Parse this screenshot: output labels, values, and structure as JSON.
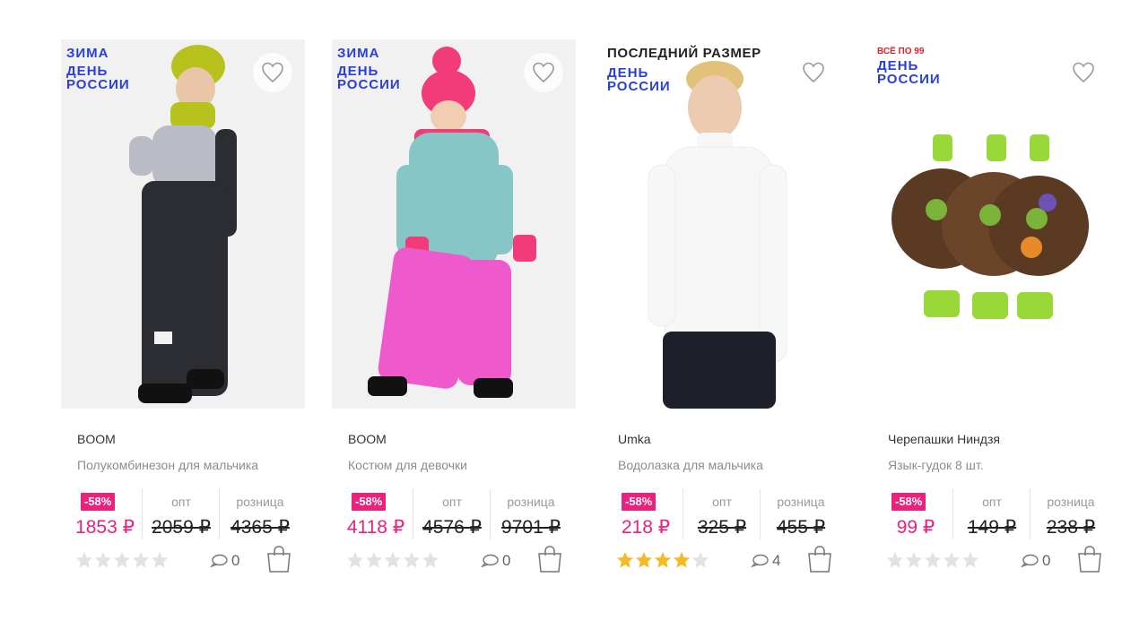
{
  "colors": {
    "accent_pink": "#e8227d",
    "badge_blue": "#2a3ee0",
    "badge_red": "#e0202a",
    "star_filled": "#f6b928",
    "star_empty": "#e2e2e2"
  },
  "products": [
    {
      "badges": {
        "top": "ЗИМА",
        "day": "ДЕНЬ РОССИИ"
      },
      "brand": "BOOM",
      "title": "Полукомбинезон для мальчика",
      "discount": "-58%",
      "price_now": "1853 ₽",
      "opt_label": "опт",
      "opt_price": "2059 ₽",
      "retail_label": "розница",
      "retail_price": "4365 ₽",
      "rating": 0,
      "reviews": "0"
    },
    {
      "badges": {
        "top": "ЗИМА",
        "day": "ДЕНЬ РОССИИ"
      },
      "brand": "BOOM",
      "title": "Костюм для девочки",
      "discount": "-58%",
      "price_now": "4118 ₽",
      "opt_label": "опт",
      "opt_price": "4576 ₽",
      "retail_label": "розница",
      "retail_price": "9701 ₽",
      "rating": 0,
      "reviews": "0"
    },
    {
      "badges": {
        "top": "ПОСЛЕДНИЙ РАЗМЕР",
        "day": "ДЕНЬ РОССИИ"
      },
      "brand": "Umka",
      "title": "Водолазка для мальчика",
      "discount": "-58%",
      "price_now": "218 ₽",
      "opt_label": "опт",
      "opt_price": "325 ₽",
      "retail_label": "розница",
      "retail_price": "455 ₽",
      "rating": 4,
      "reviews": "4"
    },
    {
      "badges": {
        "top": "ВСЁ ПО 99",
        "day": "ДЕНЬ РОССИИ"
      },
      "brand": "Черепашки Ниндзя",
      "title": "Язык-гудок 8 шт.",
      "discount": "-58%",
      "price_now": "99 ₽",
      "opt_label": "опт",
      "opt_price": "149 ₽",
      "retail_label": "розница",
      "retail_price": "238 ₽",
      "rating": 0,
      "reviews": "0"
    }
  ]
}
